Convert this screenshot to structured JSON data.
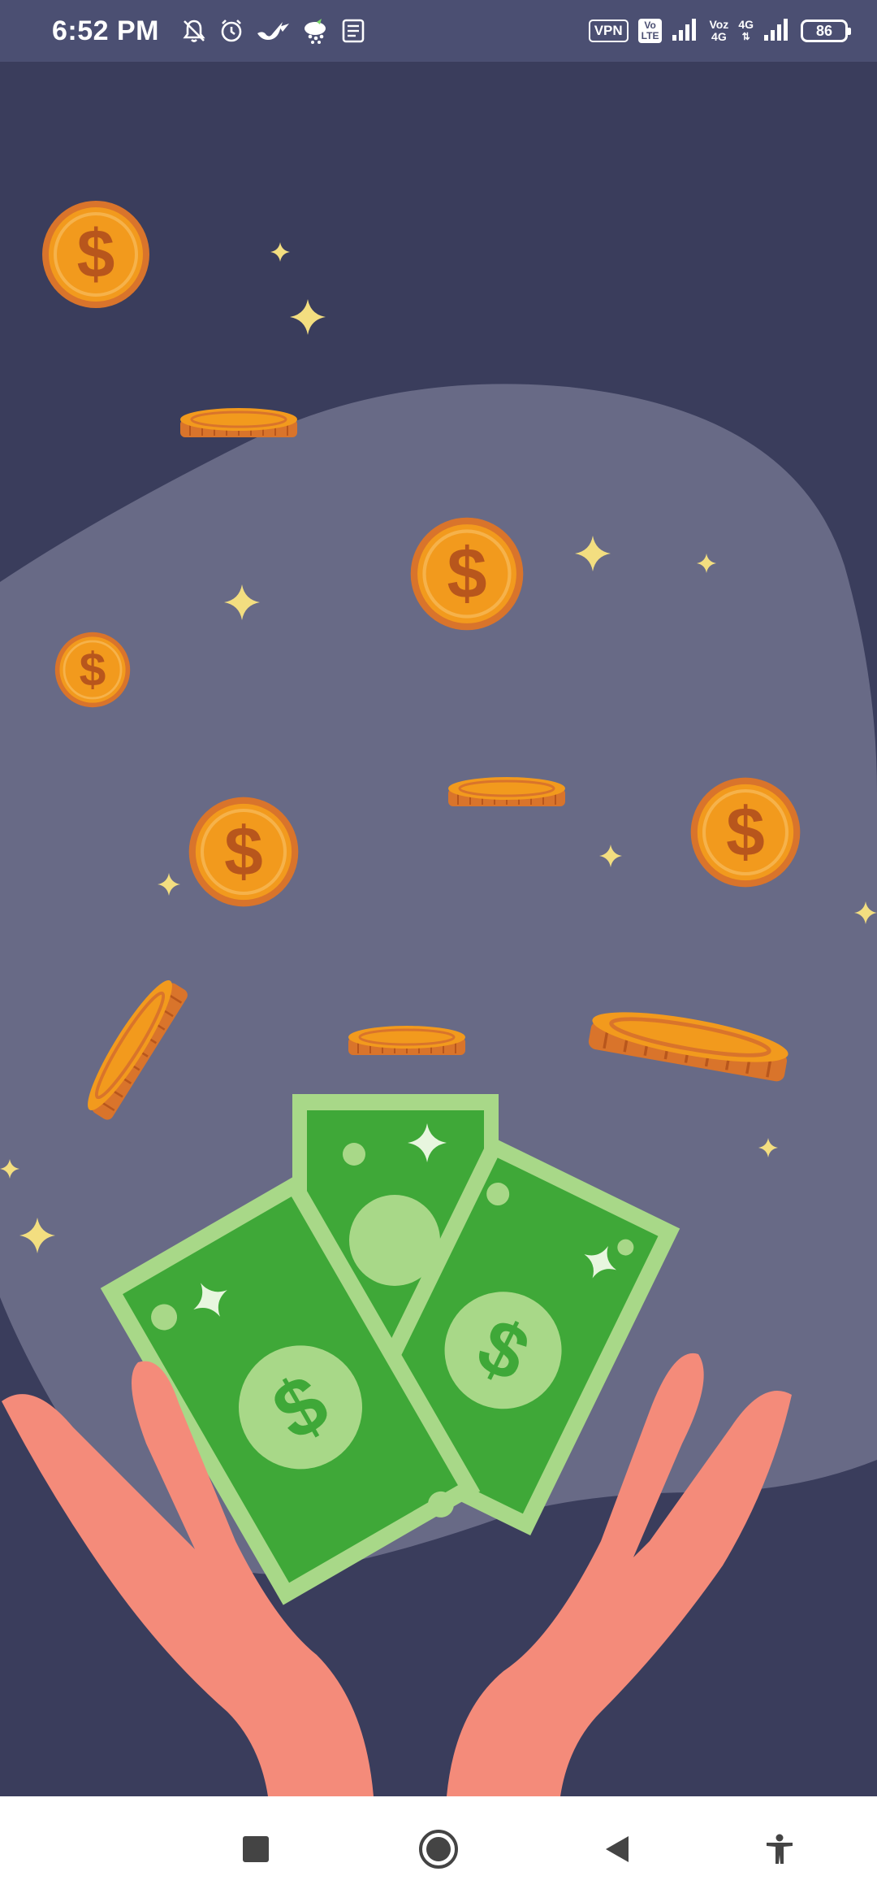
{
  "status_bar": {
    "time": "6:52 PM",
    "vpn_label": "VPN",
    "volte_label_top": "Vo",
    "volte_label_bottom": "LTE",
    "voz_label_top": "Voz",
    "voz_label_bottom": "4G",
    "network2_label_top": "4G",
    "battery_level": "86",
    "left_icons": [
      "notifications-muted-icon",
      "alarm-icon",
      "bird-icon",
      "weather-icon",
      "news-icon"
    ],
    "right_icons": [
      "vpn-icon",
      "volte-icon",
      "signal-icon",
      "voz-4g-icon",
      "signal-icon",
      "battery-icon"
    ]
  },
  "navigation_bar": {
    "buttons": [
      "recents-button",
      "home-button",
      "back-button",
      "accessibility-button"
    ]
  },
  "illustration": {
    "subject": "coins-and-cash-in-hands-icon",
    "colors": {
      "background": "#3a3d5c",
      "blob": "#686a86",
      "coin": "#f29a1d",
      "coin_edge": "#d9742b",
      "cash_light": "#a8d888",
      "cash_dark": "#3fa838",
      "hands": "#f48b7a",
      "sparkle": "#f3de80"
    }
  }
}
